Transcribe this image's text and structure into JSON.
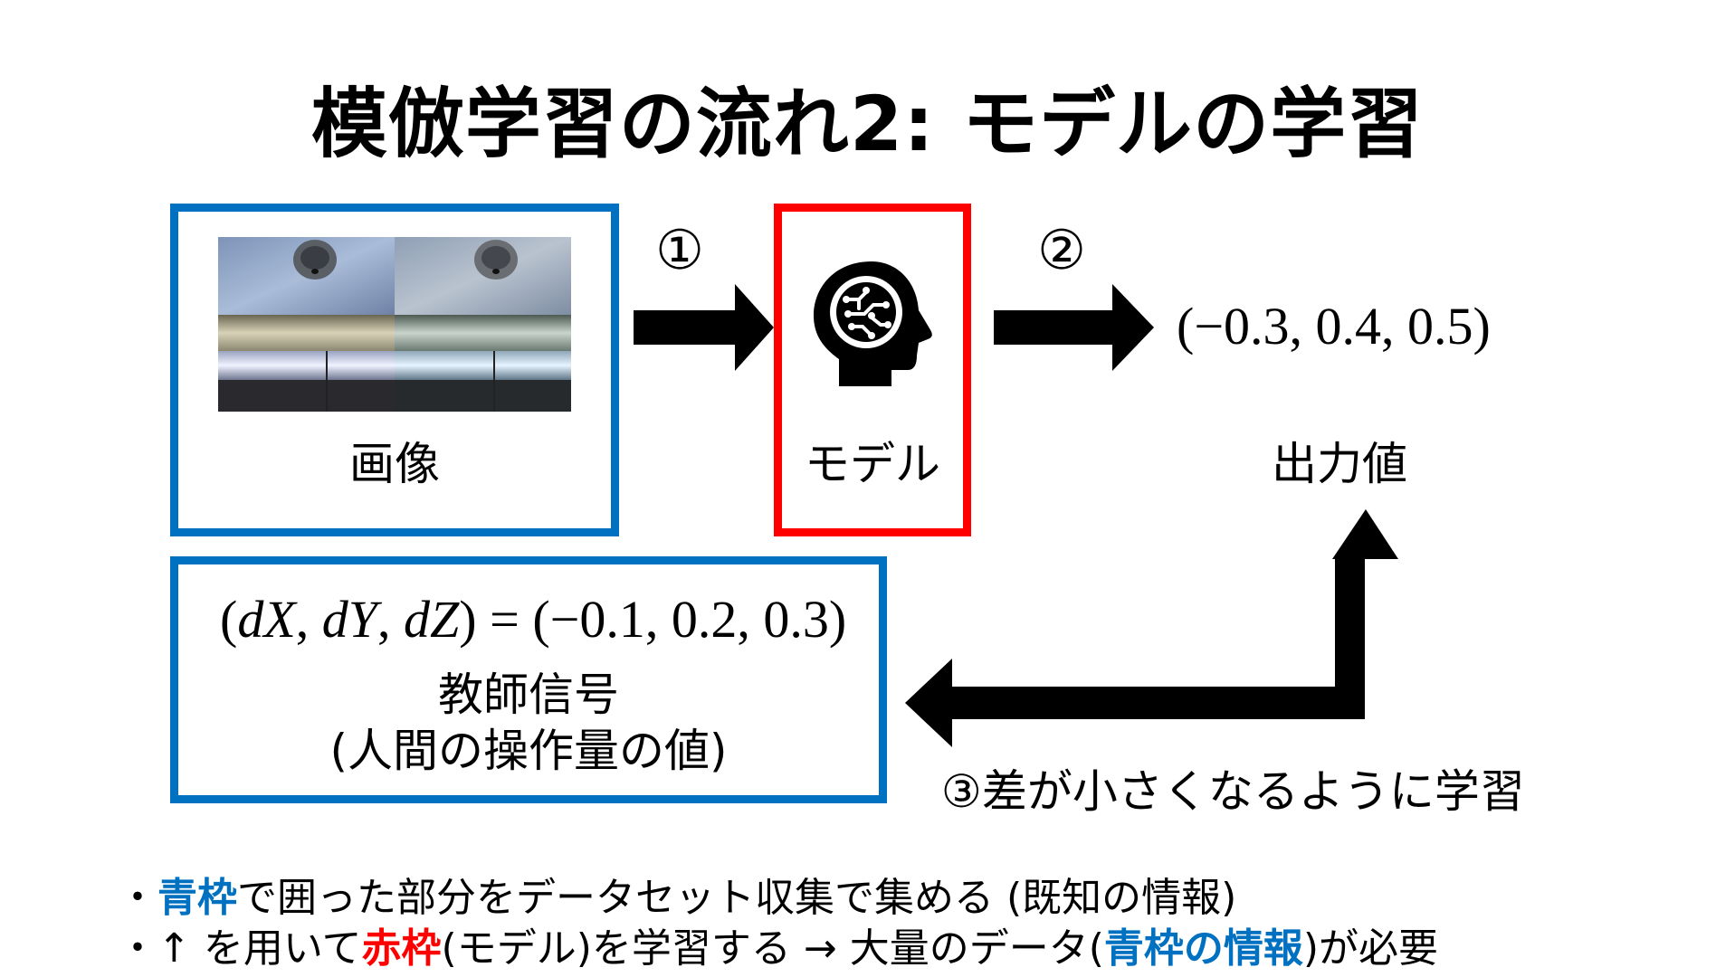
{
  "title": "模倣学習の流れ2: モデルの学習",
  "nodes": {
    "image_label": "画像",
    "model_label": "モデル",
    "output_label": "出力値",
    "output_value": "(−0.3, 0.4, 0.5)"
  },
  "steps": {
    "step1": "①",
    "step2": "②",
    "step3_num": "③",
    "step3_text": "差が小さくなるように学習"
  },
  "teacher": {
    "formula": {
      "lparen": "(",
      "d1": "d",
      "X": "X",
      "comma1": ", ",
      "d2": "d",
      "Y": "Y",
      "comma2": ", ",
      "d3": "d",
      "Z": "Z",
      "rparen": ")",
      "equals": " = ",
      "values": "(−0.1, 0.2, 0.3)"
    },
    "line1": "教師信号",
    "line2": "(人間の操作量の値)"
  },
  "bullets": {
    "b1_dot": "・",
    "b1_blue": "青枠",
    "b1_text": "で囲った部分をデータセット収集で集める (既知の情報)",
    "b2_dot": "・",
    "b2_text1": "↑ を用いて",
    "b2_red": "赤枠",
    "b2_text2": "(モデル)を学習する → 大量のデータ(",
    "b2_blue": "青枠の情報",
    "b2_text3": ")が必要"
  },
  "icons": {
    "model": "brain-circuit-head-icon"
  },
  "colors": {
    "blue_frame": "#0070c0",
    "red_frame": "#ff0000",
    "arrow": "#000000"
  }
}
